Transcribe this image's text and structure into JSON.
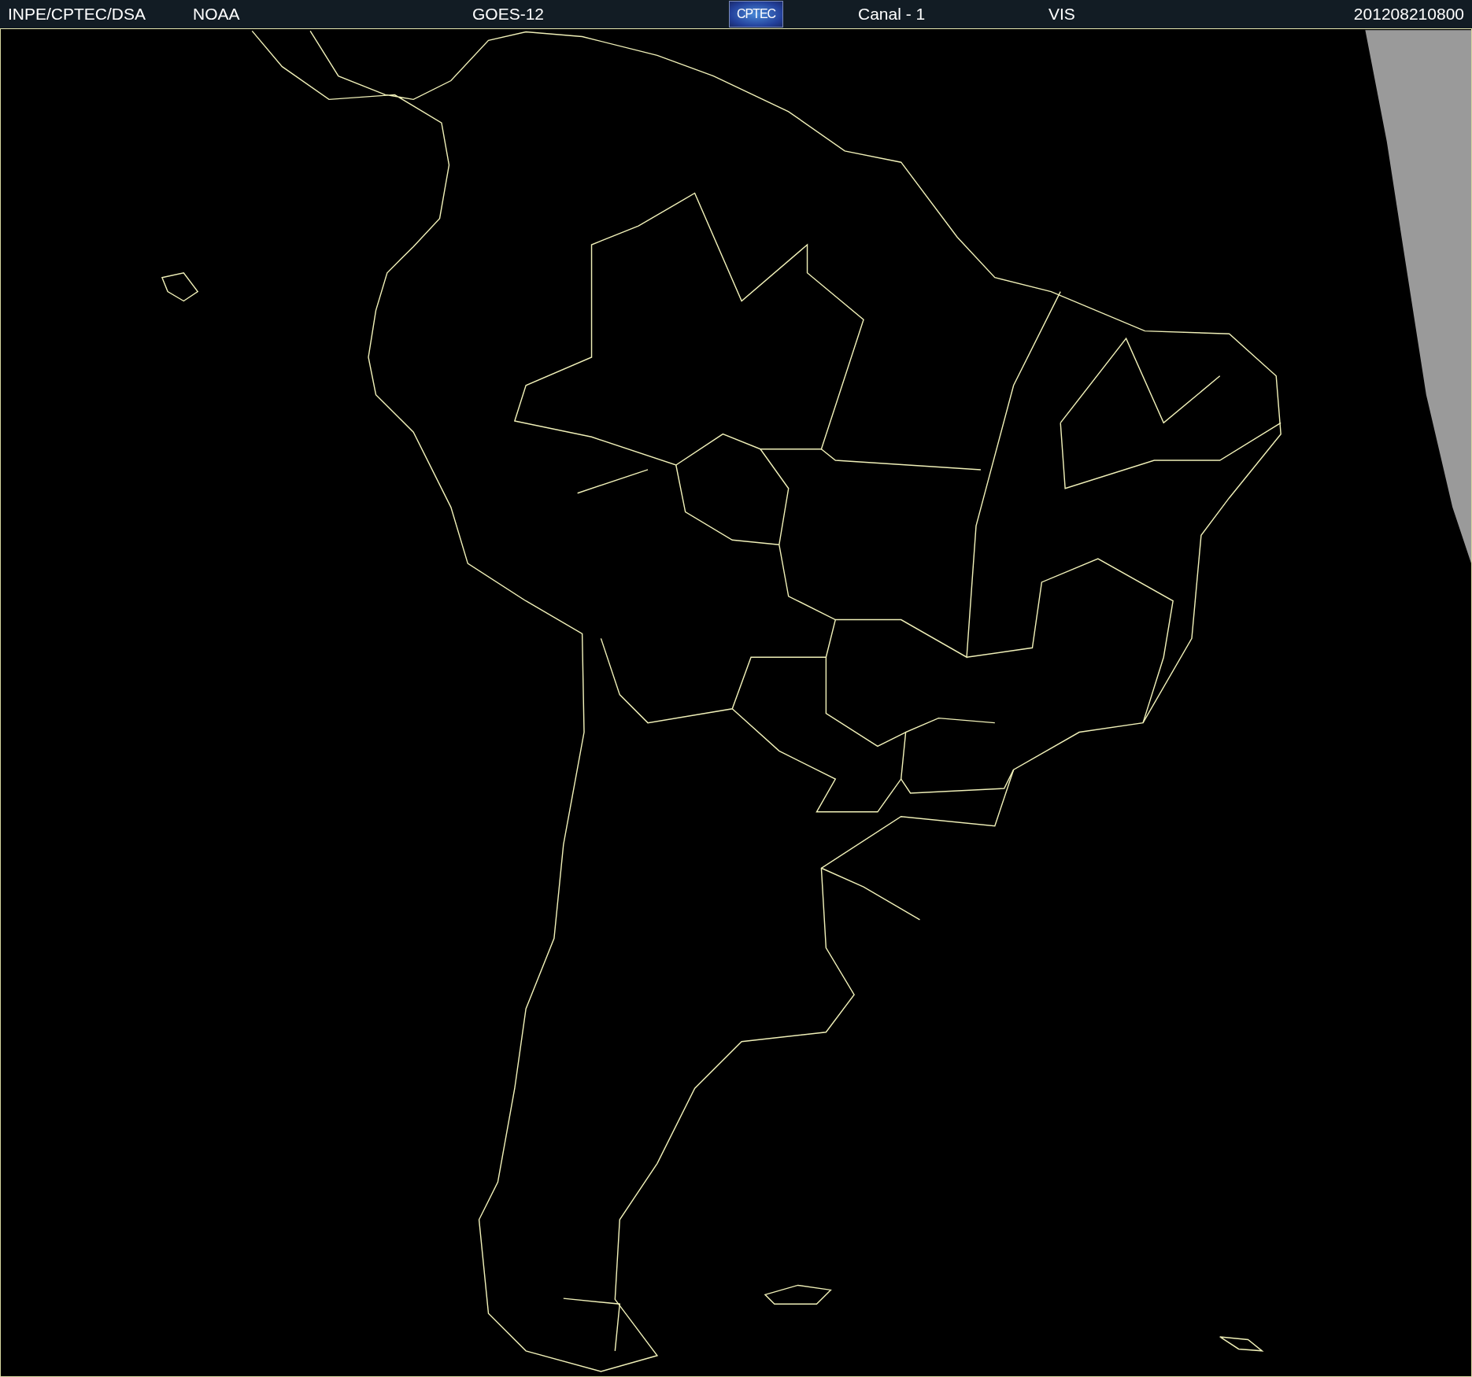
{
  "header": {
    "institution": "INPE/CPTEC/DSA",
    "source": "NOAA",
    "satellite": "GOES-12",
    "logo": "CPTEC",
    "channel": "Canal - 1",
    "band": "VIS",
    "timestamp": "201208210800"
  }
}
